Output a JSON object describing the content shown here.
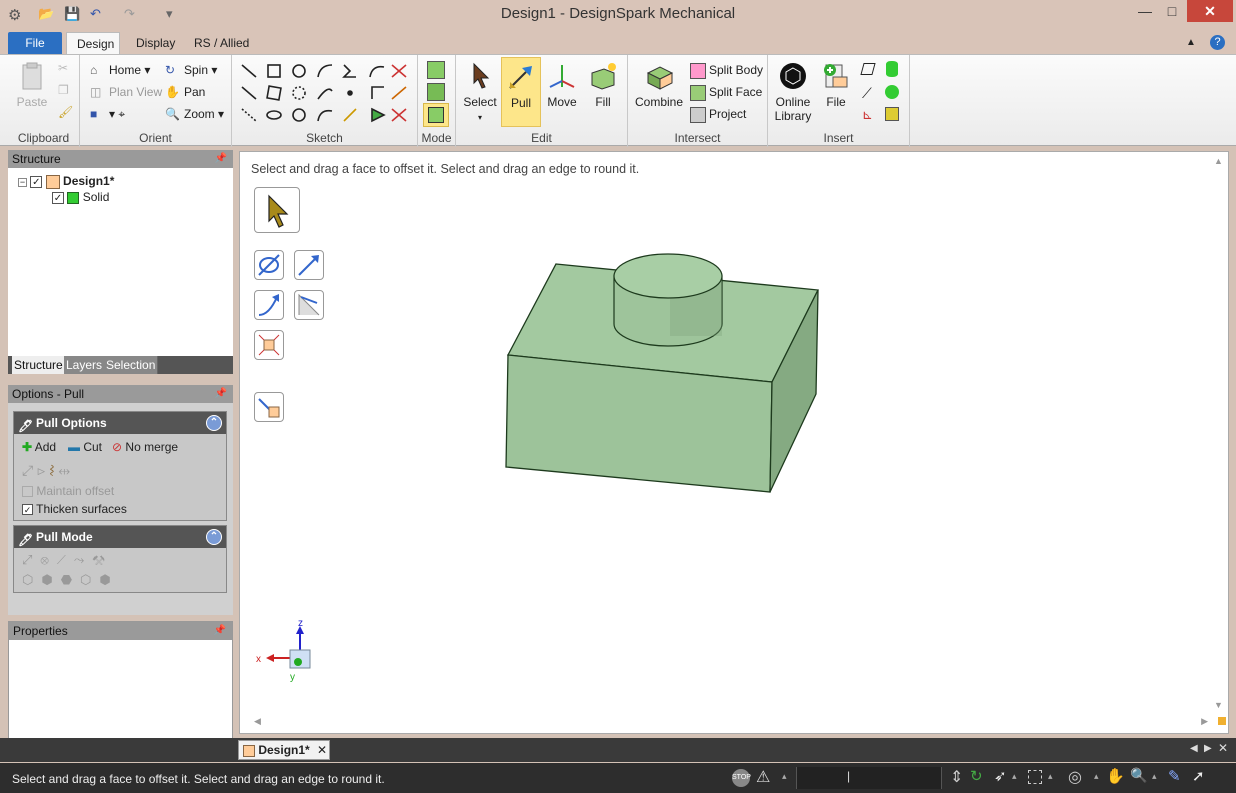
{
  "window": {
    "title": "Design1 - DesignSpark Mechanical",
    "minimize": "—",
    "maximize": "□",
    "close": "✕"
  },
  "tabs": [
    {
      "label": "File"
    },
    {
      "label": "Design"
    },
    {
      "label": "Display"
    },
    {
      "label": "RS / Allied"
    }
  ],
  "ribbon": {
    "clipboard": {
      "label": "Clipboard",
      "paste": "Paste"
    },
    "orient": {
      "label": "Orient",
      "home": "Home",
      "plan_view": "Plan View",
      "spin": "Spin",
      "pan": "Pan",
      "zoom": "Zoom"
    },
    "sketch": {
      "label": "Sketch"
    },
    "mode": {
      "label": "Mode"
    },
    "edit": {
      "label": "Edit",
      "select": "Select",
      "pull": "Pull",
      "move": "Move",
      "fill": "Fill"
    },
    "intersect": {
      "label": "Intersect",
      "combine": "Combine",
      "split_body": "Split Body",
      "split_face": "Split Face",
      "project": "Project"
    },
    "insert": {
      "label": "Insert",
      "online_library_1": "Online",
      "online_library_2": "Library",
      "file": "File"
    }
  },
  "structure": {
    "title": "Structure",
    "tree": [
      {
        "label": "Design1*"
      },
      {
        "label": "Solid"
      }
    ],
    "tabs": [
      "Structure",
      "Layers",
      "Selection"
    ]
  },
  "options": {
    "title": "Options - Pull",
    "pull_options": {
      "title": "Pull Options",
      "add": "Add",
      "cut": "Cut",
      "no_merge": "No merge",
      "maintain_offset": "Maintain offset",
      "thicken_surfaces": "Thicken surfaces"
    },
    "pull_mode": {
      "title": "Pull Mode"
    }
  },
  "properties": {
    "title": "Properties"
  },
  "viewport": {
    "hint": "Select and drag a face to offset it. Select and drag an edge to round it.",
    "axes": {
      "x": "x",
      "y": "y",
      "z": "z"
    }
  },
  "doc_tabs": [
    {
      "label": "Design1*"
    }
  ],
  "status": {
    "message": "Select and drag a face to offset it. Select and drag an edge to round it."
  },
  "colors": {
    "accent": "#2b6fc2",
    "solid_face": "#a3c9a0",
    "solid_edge": "#1d3a1d",
    "highlight": "#fde68a"
  }
}
